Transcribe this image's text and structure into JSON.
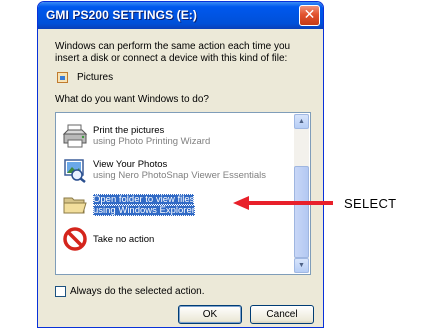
{
  "window": {
    "title": "GMI PS200 SETTINGS (E:)",
    "close_glyph": "✕",
    "intro_text": "Windows can perform the same action each time you insert a disk or connect a device with this kind of file:",
    "file_type_label": "Pictures",
    "question": "What do you want Windows to do?"
  },
  "actions": [
    {
      "title": "Print the pictures",
      "subtitle": "using Photo Printing Wizard",
      "icon": "printer-icon"
    },
    {
      "title": "View Your Photos",
      "subtitle": "using Nero PhotoSnap Viewer Essentials",
      "icon": "photo-viewer-icon"
    },
    {
      "title": "Open folder to view files",
      "subtitle": "using Windows Explorer",
      "icon": "folder-icon",
      "selected": true
    },
    {
      "title": "Take no action",
      "icon": "no-action-icon"
    }
  ],
  "checkbox": {
    "label": "Always do the selected action.",
    "checked": false
  },
  "buttons": {
    "ok": "OK",
    "cancel": "Cancel"
  },
  "annotation": {
    "label": "SELECT",
    "color": "#e8202a"
  },
  "colors": {
    "titlebar": "#0054e3",
    "selection": "#316ac5",
    "dialog_bg": "#ece9d8"
  }
}
